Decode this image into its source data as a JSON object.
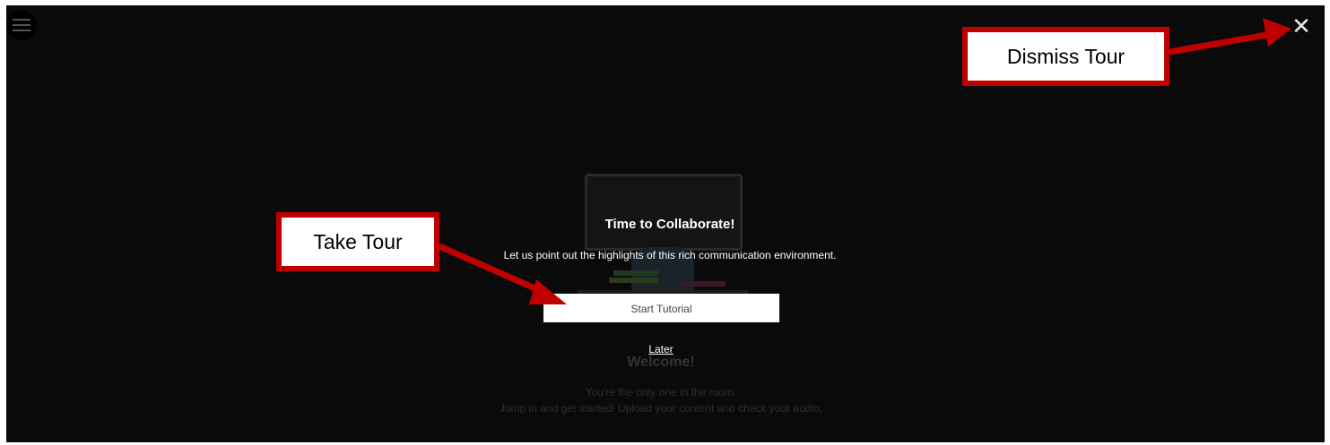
{
  "menu": {
    "icon": "hamburger-menu-icon"
  },
  "close": {
    "icon": "close-icon",
    "glyph": "✕"
  },
  "tour": {
    "title": "Time to Collaborate!",
    "description": "Let us point out the highlights of this rich communication environment.",
    "start_label": "Start Tutorial",
    "later_label": "Later"
  },
  "welcome": {
    "title": "Welcome!",
    "line1": "You're the only one in the room.",
    "line2": "Jump in and get started! Upload your content and check your audio."
  },
  "annotations": {
    "dismiss_label": "Dismiss Tour",
    "take_label": "Take Tour",
    "arrow_color": "#c00000"
  }
}
